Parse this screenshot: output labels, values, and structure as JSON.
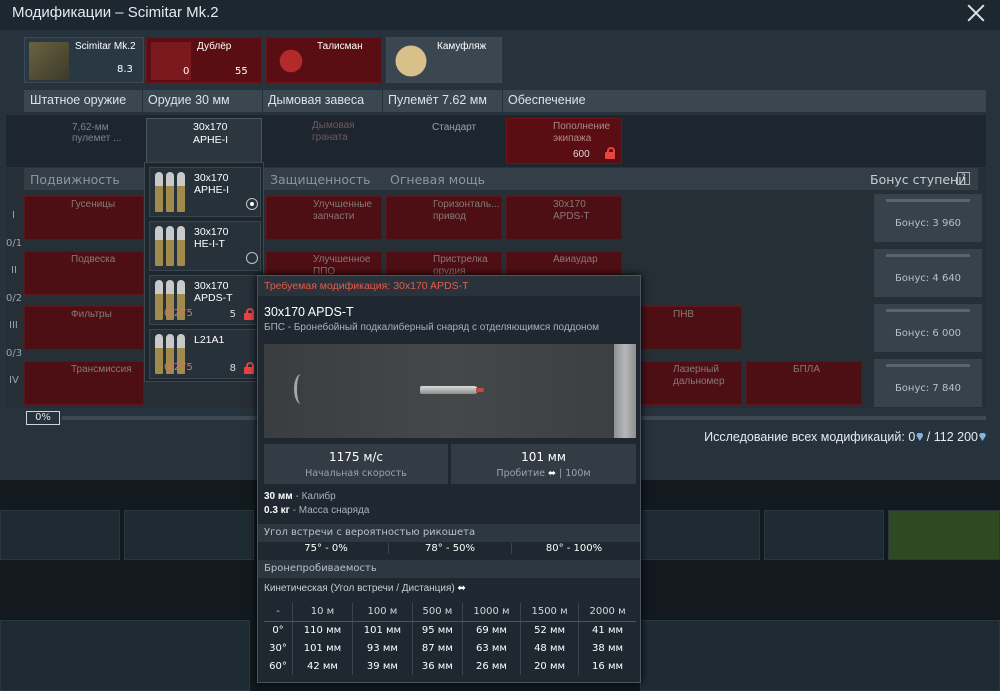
{
  "window": {
    "title": "Модификации – Scimitar Mk.2"
  },
  "top_cards": [
    {
      "label": "Scimitar Mk.2",
      "value": "8.3"
    },
    {
      "label": "Дублёр",
      "left": "0",
      "right": "55"
    },
    {
      "label": "Талисман"
    },
    {
      "label": "Камуфляж"
    }
  ],
  "tabs": [
    "Штатное оружие",
    "Орудие 30 мм",
    "Дымовая завеса",
    "Пулемёт 7.62 мм",
    "Обеспечение"
  ],
  "weapons": {
    "mg": "7,62-мм пулемет ...",
    "gun": [
      "30x170",
      "APHE-I"
    ],
    "smoke": [
      "Дымовая",
      "граната"
    ],
    "mg_belt": "Стандарт",
    "crew": [
      "Пополнение",
      "экипажа"
    ],
    "crew_cost": "600"
  },
  "categories": [
    "Подвижность",
    "Защищенность",
    "Огневая мощь",
    "Бонус ступени"
  ],
  "category_help": "?",
  "tiers": [
    "I",
    "II",
    "III",
    "IV"
  ],
  "tier_progress": [
    "0/1",
    "0/2",
    "0/3"
  ],
  "mobility": [
    "Гусеницы",
    "Подвеска",
    "Фильтры",
    "Трансмиссия"
  ],
  "protection": [
    [
      "Улучшенные",
      "запчасти"
    ],
    [
      "Улучшенное",
      "ППО"
    ]
  ],
  "firepower": [
    [
      "Горизонталь...",
      "привод"
    ],
    [
      "Пристрелка",
      "орудия"
    ]
  ],
  "fire2": [
    [
      "30x170",
      "APDS-T"
    ],
    [
      "Авиаудар"
    ]
  ],
  "extra": [
    "ПНВ",
    [
      "Лазерный",
      "дальномер"
    ],
    "БПЛА"
  ],
  "bonuses": [
    "Бонус: 3 960",
    "Бонус: 4 640",
    "Бонус: 6 000",
    "Бонус: 7 840"
  ],
  "dropdown": [
    {
      "l1": "30x170",
      "l2": "APHE-I",
      "selected": true
    },
    {
      "l1": "30x170",
      "l2": "HE-I-T",
      "selected": false
    },
    {
      "l1": "30x170",
      "l2": "APDS-T",
      "progress": "0/275",
      "cost": "5"
    },
    {
      "l1": "L21A1",
      "l2": "",
      "progress": "0/275",
      "cost": "8"
    }
  ],
  "progress": {
    "percent": "0%",
    "value": 0
  },
  "research": {
    "label": "Исследование всех модификаций:",
    "current": "0",
    "total": "112 200"
  },
  "tooltip": {
    "required": "Требуемая модификация: 30x170 APDS-T",
    "name": "30x170 APDS-T",
    "desc": "БПС - Бронебойный подкалиберный снаряд с отделяющимся поддоном",
    "velocity": "1175 м/с",
    "velocity_label": "Начальная скорость",
    "penetration": "101 мм",
    "penetration_label": "Пробитие",
    "penetration_range": "| 100м",
    "caliber": "30 мм",
    "caliber_label": "- Калибр",
    "mass": "0.3 кг",
    "mass_label": "- Масса снаряда",
    "ricochet_title": "Угол встречи с вероятностью рикошета",
    "ricochet": [
      "75° - 0%",
      "78° - 50%",
      "80° - 100%"
    ],
    "pen_title": "Бронепробиваемость",
    "pen_sub": "Кинетическая (Угол встречи / Дистанция)",
    "pen_header": [
      "-",
      "10 м",
      "100 м",
      "500 м",
      "1000 м",
      "1500 м",
      "2000 м"
    ],
    "pen_rows": [
      [
        "0°",
        "110 мм",
        "101 мм",
        "95 мм",
        "69 мм",
        "52 мм",
        "41 мм"
      ],
      [
        "30°",
        "101 мм",
        "93 мм",
        "87 мм",
        "63 мм",
        "48 мм",
        "38 мм"
      ],
      [
        "60°",
        "42 мм",
        "39 мм",
        "36 мм",
        "26 мм",
        "20 мм",
        "16 мм"
      ]
    ]
  }
}
